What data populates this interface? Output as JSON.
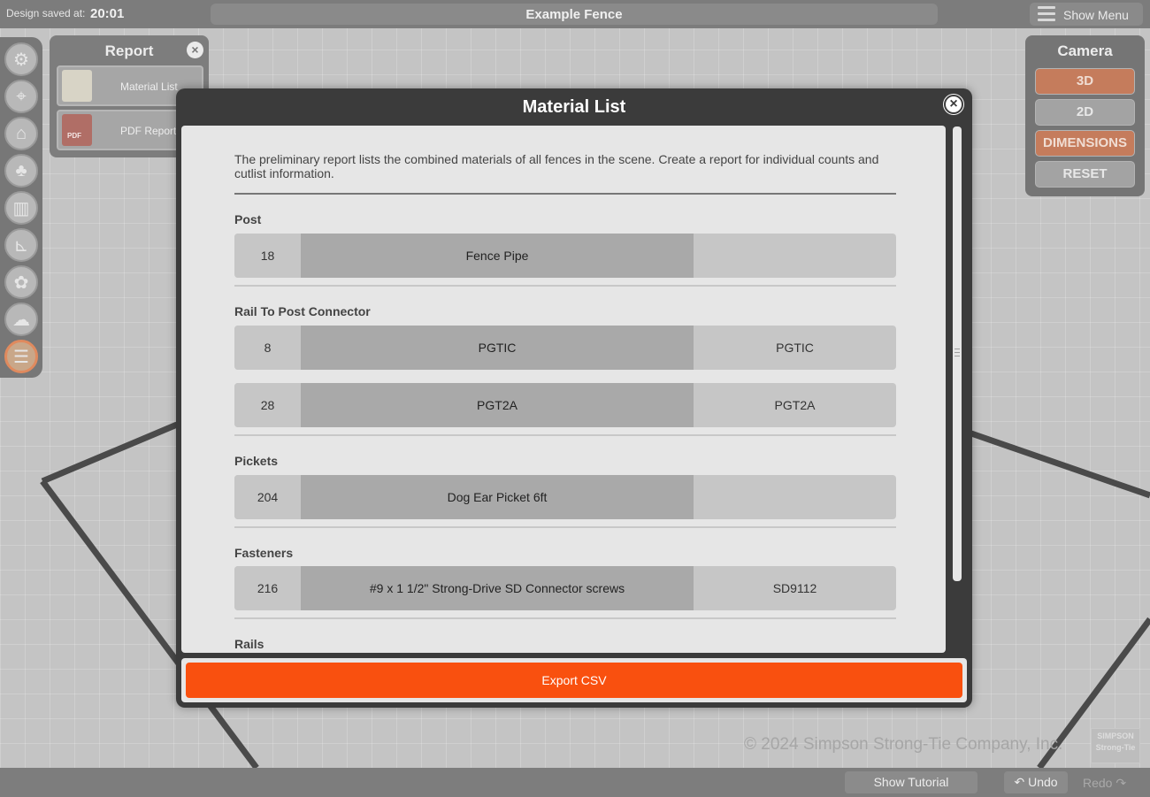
{
  "topbar": {
    "saved_label": "Design saved at:",
    "saved_time": "20:01",
    "project_title": "Example Fence",
    "menu_label": "Show Menu"
  },
  "tools": [
    {
      "icon": "gear-icon",
      "glyph": "⚙"
    },
    {
      "icon": "map-pin-icon",
      "glyph": "⌖"
    },
    {
      "icon": "house-icon",
      "glyph": "⌂"
    },
    {
      "icon": "tree-icon",
      "glyph": "♣"
    },
    {
      "icon": "fence-icon",
      "glyph": "▥"
    },
    {
      "icon": "bracket-icon",
      "glyph": "⊾"
    },
    {
      "icon": "plant-icon",
      "glyph": "✿"
    },
    {
      "icon": "weather-icon",
      "glyph": "☁"
    },
    {
      "icon": "report-icon",
      "glyph": "☰"
    }
  ],
  "report_panel": {
    "title": "Report",
    "items": [
      {
        "label": "Material List",
        "icon": "material-list-icon"
      },
      {
        "label": "PDF Report",
        "icon": "pdf-icon",
        "tag": "PDF"
      }
    ]
  },
  "camera": {
    "title": "Camera",
    "buttons": [
      {
        "label": "3D",
        "active": true
      },
      {
        "label": "2D",
        "active": false
      },
      {
        "label": "DIMENSIONS",
        "active": true
      },
      {
        "label": "RESET",
        "active": false
      }
    ]
  },
  "modal": {
    "title": "Material List",
    "intro": "The preliminary report lists the combined materials of all fences in the scene. Create a report for individual counts and cutlist information.",
    "sections": [
      {
        "label": "Post",
        "rows": [
          {
            "qty": "18",
            "name": "Fence Pipe",
            "sku": ""
          }
        ]
      },
      {
        "label": "Rail To Post Connector",
        "rows": [
          {
            "qty": "8",
            "name": "PGTIC",
            "sku": "PGTIC"
          },
          {
            "qty": "28",
            "name": "PGT2A",
            "sku": "PGT2A"
          }
        ]
      },
      {
        "label": "Pickets",
        "rows": [
          {
            "qty": "204",
            "name": "Dog Ear Picket 6ft",
            "sku": ""
          }
        ]
      },
      {
        "label": "Fasteners",
        "rows": [
          {
            "qty": "216",
            "name": "#9 x 1 1/2\" Strong-Drive SD Connector screws",
            "sku": "SD9112"
          }
        ]
      },
      {
        "label": "Rails",
        "rows": []
      }
    ],
    "export_label": "Export CSV"
  },
  "footer": {
    "copyright": "© 2024 Simpson Strong-Tie Company, Inc.",
    "logo_top": "SIMPSON",
    "logo_bottom": "Strong-Tie",
    "tutorial_label": "Show Tutorial",
    "undo_label": "Undo",
    "redo_label": "Redo"
  },
  "colors": {
    "accent": "#f9500f",
    "camera_active": "#c57c5c",
    "modal_frame": "#3b3b3b"
  }
}
